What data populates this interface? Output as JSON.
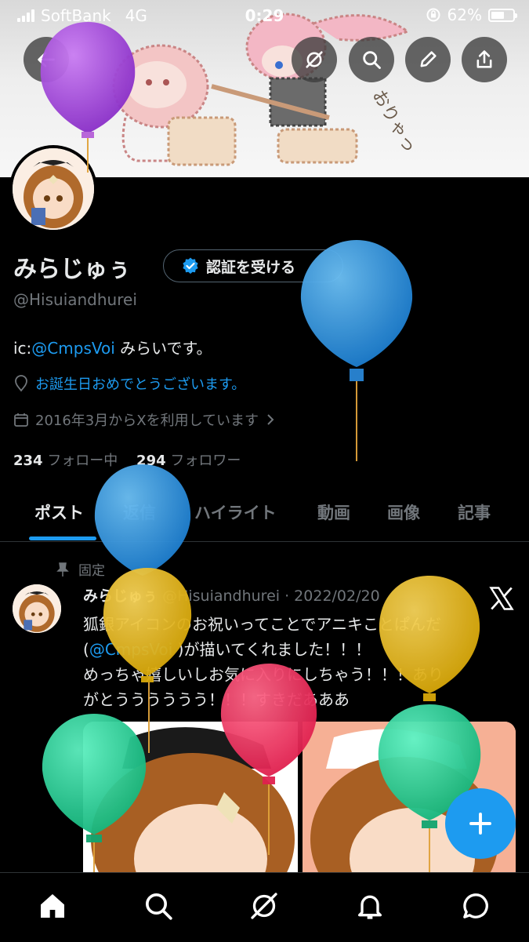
{
  "status_bar": {
    "carrier": "SoftBank",
    "network": "4G",
    "time": "0:29",
    "battery": "62%",
    "battery_level": 0.62
  },
  "header_buttons": [
    "back-icon",
    "grok-icon",
    "search-icon",
    "edit-icon",
    "share-icon"
  ],
  "profile": {
    "name": "みらじゅぅ",
    "verify_label": "認証を受ける",
    "handle": "@Hisuiandhurei",
    "bio_prefix": "ic:",
    "bio_link": "@CmpsVoi",
    "bio_suffix": " みらいです。",
    "location": "お誕生日おめでとうございます。",
    "joined": "2016年3月からXを利用しています",
    "following_count": "234",
    "following_label": "フォロー中",
    "followers_count": "294",
    "followers_label": "フォロワー"
  },
  "tabs": [
    "ポスト",
    "返信",
    "ハイライト",
    "動画",
    "画像",
    "記事"
  ],
  "active_tab": "ポスト",
  "post": {
    "pinned_label": "固定",
    "author": "みらじゅぅ",
    "handle": "@Hisuiandhurei",
    "date": "· 2022/02/20",
    "line1": "狐銀アイコンのお祝いってことでアニキことぱんだ",
    "line2_open": "(",
    "line2_link": "@CmpsVoi",
    "line2_rest": " )が描いてくれました！！！",
    "line3": "めっちゃ嬉しいしお気に入りにしちゃう！！！あり",
    "line4": "がとうううううう！！！すきだあああ"
  },
  "colors": {
    "accent": "#1d9bf0",
    "background": "#000000",
    "muted": "#71767b",
    "text": "#e7e9ea"
  }
}
